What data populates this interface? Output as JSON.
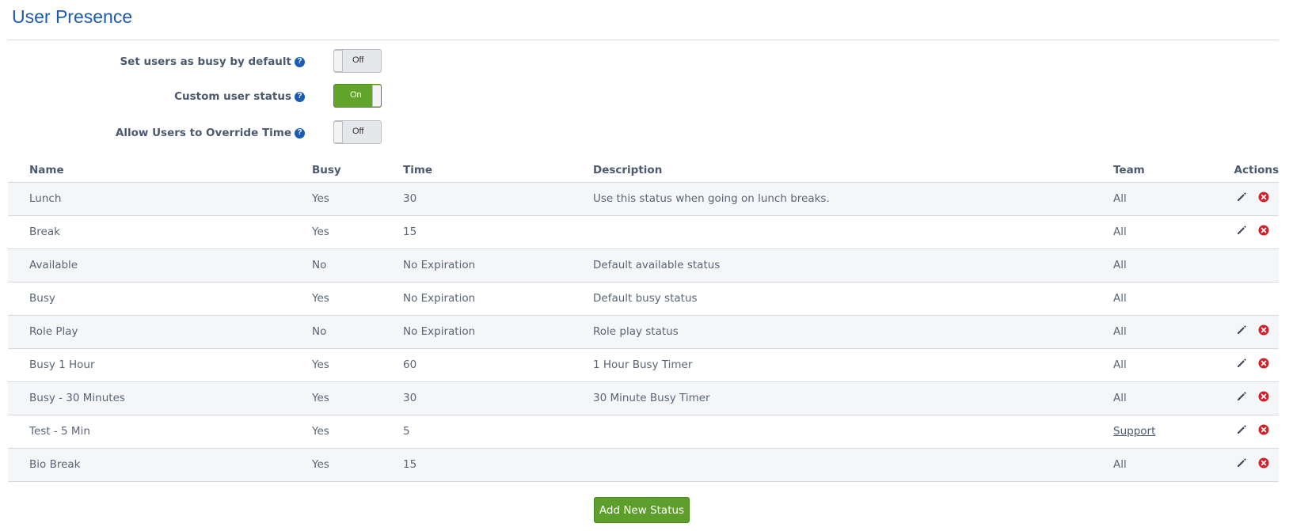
{
  "page": {
    "title": "User Presence"
  },
  "settings": [
    {
      "label": "Set users as busy by default",
      "state": "Off",
      "on": false
    },
    {
      "label": "Custom user status",
      "state": "On",
      "on": true
    },
    {
      "label": "Allow Users to Override Time",
      "state": "Off",
      "on": false
    }
  ],
  "table": {
    "headers": {
      "name": "Name",
      "busy": "Busy",
      "time": "Time",
      "description": "Description",
      "team": "Team",
      "actions": "Actions"
    },
    "rows": [
      {
        "name": "Lunch",
        "busy": "Yes",
        "time": "30",
        "description": "Use this status when going on lunch breaks.",
        "team": "All",
        "team_link": false,
        "actions": true
      },
      {
        "name": "Break",
        "busy": "Yes",
        "time": "15",
        "description": "",
        "team": "All",
        "team_link": false,
        "actions": true
      },
      {
        "name": "Available",
        "busy": "No",
        "time": "No Expiration",
        "description": "Default available status",
        "team": "All",
        "team_link": false,
        "actions": false
      },
      {
        "name": "Busy",
        "busy": "Yes",
        "time": "No Expiration",
        "description": "Default busy status",
        "team": "All",
        "team_link": false,
        "actions": false
      },
      {
        "name": "Role Play",
        "busy": "No",
        "time": "No Expiration",
        "description": "Role play status",
        "team": "All",
        "team_link": false,
        "actions": true
      },
      {
        "name": "Busy 1 Hour",
        "busy": "Yes",
        "time": "60",
        "description": "1 Hour Busy Timer",
        "team": "All",
        "team_link": false,
        "actions": true
      },
      {
        "name": "Busy - 30 Minutes",
        "busy": "Yes",
        "time": "30",
        "description": "30 Minute Busy Timer",
        "team": "All",
        "team_link": false,
        "actions": true
      },
      {
        "name": "Test - 5 Min",
        "busy": "Yes",
        "time": "5",
        "description": "",
        "team": "Support",
        "team_link": true,
        "actions": true
      },
      {
        "name": "Bio Break",
        "busy": "Yes",
        "time": "15",
        "description": "",
        "team": "All",
        "team_link": false,
        "actions": true
      }
    ]
  },
  "add_button": {
    "label": "Add New Status"
  },
  "icons": {
    "help": "question-circle-icon",
    "edit": "pencil-icon",
    "delete": "delete-circle-icon"
  },
  "colors": {
    "title": "#1d5bb0",
    "toggle_on": "#62a32b",
    "button": "#5e9e2c",
    "delete": "#d0202a",
    "help": "#1a5bb8"
  }
}
